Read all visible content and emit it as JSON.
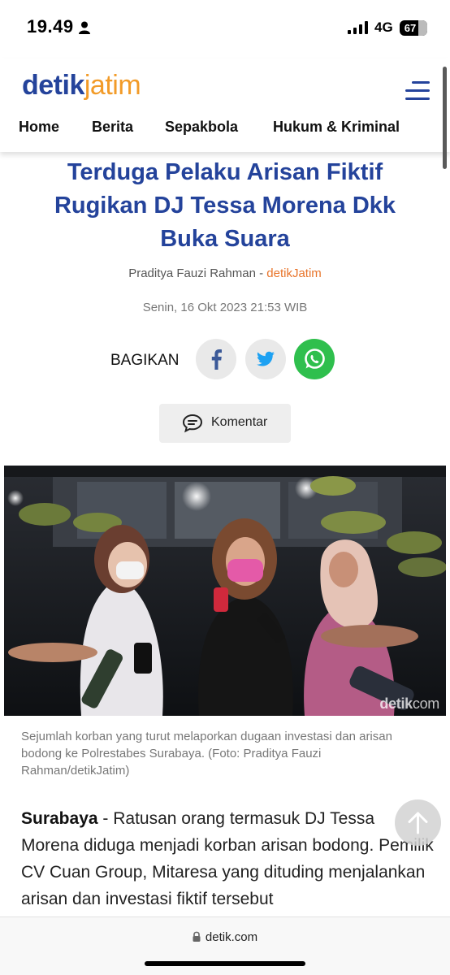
{
  "status_bar": {
    "time": "19.49",
    "network": "4G",
    "battery_percent": 67,
    "battery_label": "67"
  },
  "header": {
    "logo_part1": "detik",
    "logo_part2": "jatim",
    "nav_items": [
      "Home",
      "Berita",
      "Sepakbola",
      "Hukum & Kriminal"
    ],
    "colors": {
      "brand_blue": "#24439b",
      "brand_orange": "#f29b28"
    }
  },
  "article": {
    "title_lines": [
      "Terduga Pelaku Arisan Fiktif",
      "Rugikan DJ Tessa Morena Dkk",
      "Buka Suara"
    ],
    "author": "Praditya Fauzi Rahman",
    "separator": " - ",
    "source": "detikJatim",
    "date": "Senin, 16 Okt 2023 21:53 WIB",
    "share_label": "BAGIKAN",
    "share_icons": [
      "facebook-icon",
      "twitter-icon",
      "whatsapp-icon"
    ],
    "comment_label": "Komentar",
    "photo_watermark_a": "detik",
    "photo_watermark_b": "com",
    "caption": "Sejumlah korban yang turut melaporkan dugaan investasi dan arisan bodong ke Polrestabes Surabaya. (Foto: Praditya Fauzi Rahman/detikJatim)",
    "body_lead": "Surabaya",
    "body_text": " - Ratusan orang termasuk DJ Tessa Morena diduga menjadi korban arisan bodong. Pemilik CV Cuan Group, Mitaresa yang dituding menjalankan arisan dan investasi fiktif tersebut"
  },
  "browser": {
    "url": "detik.com"
  }
}
